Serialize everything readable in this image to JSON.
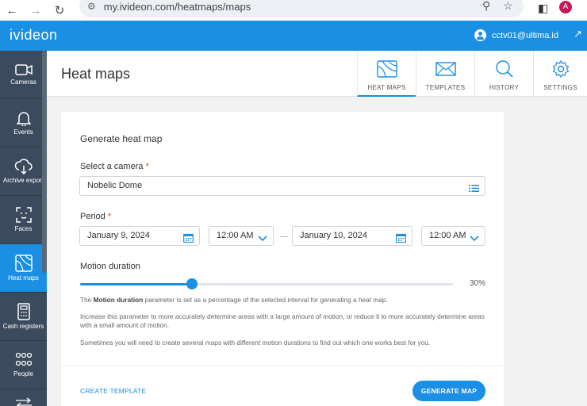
{
  "browser": {
    "url": "my.ivideon.com/heatmaps/maps",
    "profile_initial": "A"
  },
  "app": {
    "logo": "ivideon",
    "user_email": "cctv01@ultima.id"
  },
  "sidebar": {
    "items": [
      {
        "label": "Cameras",
        "icon": "camera-icon"
      },
      {
        "label": "Events",
        "icon": "bell-icon"
      },
      {
        "label": "Archive export",
        "icon": "cloud-download-icon"
      },
      {
        "label": "Faces",
        "icon": "face-scan-icon"
      },
      {
        "label": "Heat maps",
        "icon": "heatmap-icon",
        "active": true
      },
      {
        "label": "Cash registers",
        "icon": "cash-register-icon"
      },
      {
        "label": "People",
        "icon": "people-icon"
      }
    ]
  },
  "header": {
    "title": "Heat maps",
    "tabs": [
      {
        "label": "HEAT MAPS",
        "icon": "heatmap-icon",
        "active": true
      },
      {
        "label": "TEMPLATES",
        "icon": "envelope-icon"
      },
      {
        "label": "HISTORY",
        "icon": "search-icon"
      },
      {
        "label": "SETTINGS",
        "icon": "gear-icon"
      }
    ]
  },
  "form": {
    "title": "Generate heat map",
    "camera_label": "Select a camera",
    "required_mark": "*",
    "camera_value": "Nobelic Dome",
    "period_label": "Period",
    "start_date": "January 9, 2024",
    "start_time": "12:00 AM",
    "end_date": "January 10, 2024",
    "end_time": "12:00 AM",
    "motion_label": "Motion duration",
    "motion_percent": 30,
    "motion_value_text": "30%",
    "help1_prefix": "The ",
    "help1_bold": "Motion duration",
    "help1_suffix": " parameter is set as a percentage of the selected interval for generating a heat map.",
    "help2": "Increase this parameter to more accurately determine areas with a large amount of motion, or reduce it to more accurately determine areas with a small amount of motion.",
    "help3": "Sometimes you will need to create several maps with different motion durations to find out which one works best for you.",
    "create_template": "CREATE TEMPLATE",
    "generate_button": "GENERATE MAP"
  },
  "colors": {
    "accent": "#1a8fe3",
    "sidebar": "#3b4a5c"
  }
}
